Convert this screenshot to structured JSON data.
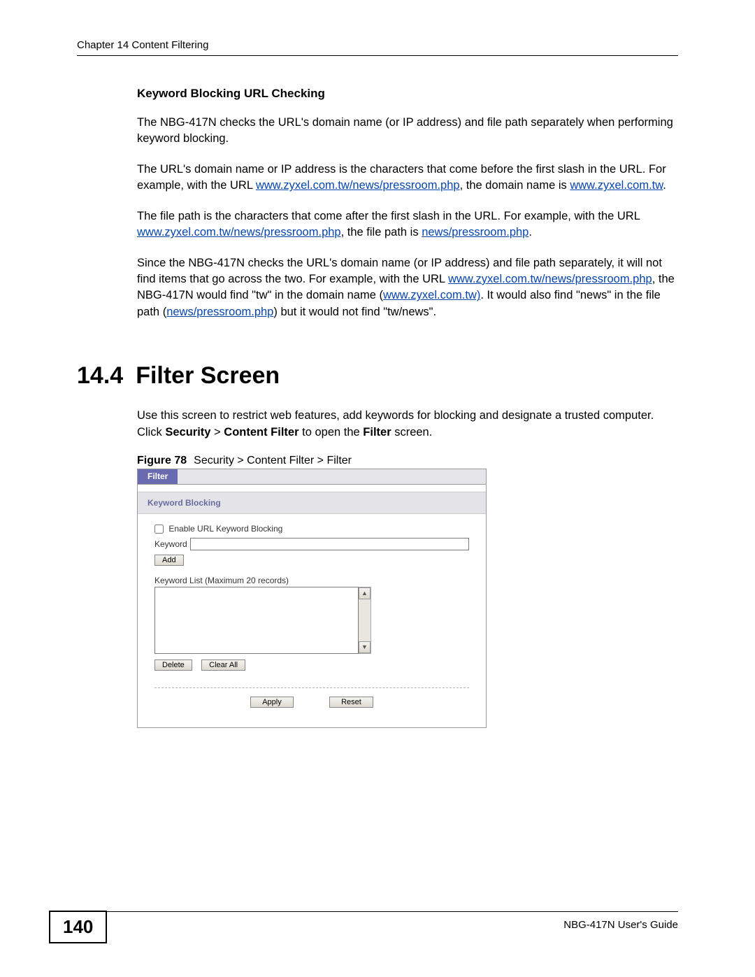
{
  "header": {
    "chapter": "Chapter 14 Content Filtering"
  },
  "sub1": {
    "title": "Keyword Blocking URL Checking",
    "p1": "The NBG-417N checks the URL's domain name (or IP address) and file path separately when performing keyword blocking.",
    "p2a": "The URL's domain name or IP address is the characters that come before the first slash in the URL. For example, with the URL ",
    "p2_link1": "www.zyxel.com.tw/news/pressroom.php",
    "p2b": ", the domain name is ",
    "p2_link2": "www.zyxel.com.tw",
    "p2c": ".",
    "p3a": "The file path is the characters that come after the first slash in the URL. For example, with the URL ",
    "p3_link1": "www.zyxel.com.tw/news/pressroom.php",
    "p3b": ", the file path is ",
    "p3_link2": "news/pressroom.php",
    "p3c": ".",
    "p4a": "Since the NBG-417N checks the URL's domain name (or IP address) and file path separately, it will not find items that go across the two. For example, with the URL ",
    "p4_link1": "www.zyxel.com.tw/news/pressroom.php",
    "p4b": ", the NBG-417N would find \"tw\" in the domain name (",
    "p4_link2": "www.zyxel.com.tw)",
    "p4c": ". It would also find \"news\" in the file path (",
    "p4_link3": "news/pressroom.php",
    "p4d": ") but it would not find \"tw/news\"."
  },
  "section": {
    "num": "14.4",
    "title": "Filter Screen",
    "p1a": "Use this screen to restrict web features, add keywords for blocking and designate a trusted computer. Click ",
    "b1": "Security",
    "gt1": " > ",
    "b2": "Content Filter",
    "p1b": " to open the ",
    "b3": "Filter",
    "p1c": " screen."
  },
  "figure": {
    "label": "Figure 78",
    "caption": "Security > Content Filter > Filter"
  },
  "ui": {
    "tab": "Filter",
    "section_label": "Keyword Blocking",
    "enable_label": "Enable URL Keyword Blocking",
    "keyword_label": "Keyword",
    "add_btn": "Add",
    "list_label": "Keyword List (Maximum 20 records)",
    "delete_btn": "Delete",
    "clearall_btn": "Clear All",
    "apply_btn": "Apply",
    "reset_btn": "Reset"
  },
  "footer": {
    "page": "140",
    "guide": "NBG-417N User's Guide"
  }
}
